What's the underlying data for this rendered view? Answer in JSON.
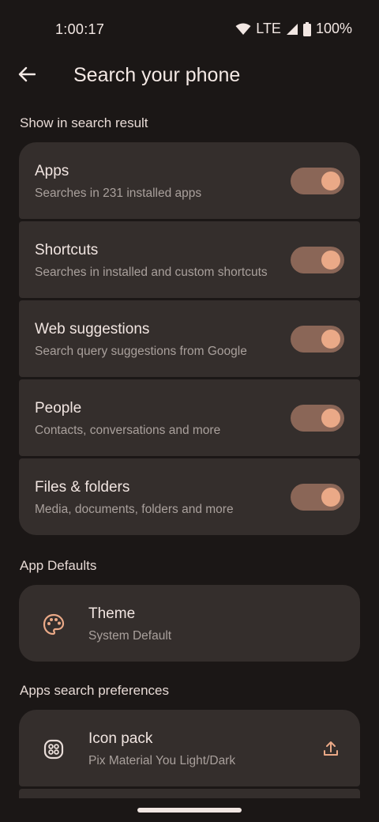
{
  "status": {
    "time": "1:00:17",
    "network": "LTE",
    "battery": "100%"
  },
  "header": {
    "title": "Search your phone"
  },
  "sections": {
    "search_result": {
      "label": "Show in search result",
      "items": [
        {
          "title": "Apps",
          "subtitle": "Searches in 231 installed apps",
          "enabled": true
        },
        {
          "title": "Shortcuts",
          "subtitle": "Searches in installed and custom shortcuts",
          "enabled": true
        },
        {
          "title": "Web suggestions",
          "subtitle": "Search query suggestions from Google",
          "enabled": true
        },
        {
          "title": "People",
          "subtitle": "Contacts, conversations and more",
          "enabled": true
        },
        {
          "title": "Files & folders",
          "subtitle": "Media, documents, folders and more",
          "enabled": true
        }
      ]
    },
    "app_defaults": {
      "label": "App Defaults",
      "theme": {
        "title": "Theme",
        "subtitle": "System Default",
        "icon": "palette-icon"
      }
    },
    "apps_search_prefs": {
      "label": "Apps search preferences",
      "icon_pack": {
        "title": "Icon pack",
        "subtitle": "Pix Material You Light/Dark",
        "icon": "icon-pack-icon",
        "action_icon": "upload-icon"
      }
    }
  },
  "colors": {
    "background": "#1b1716",
    "card": "#342e2c",
    "accent": "#eaa987",
    "toggle_track": "#8a6657"
  }
}
